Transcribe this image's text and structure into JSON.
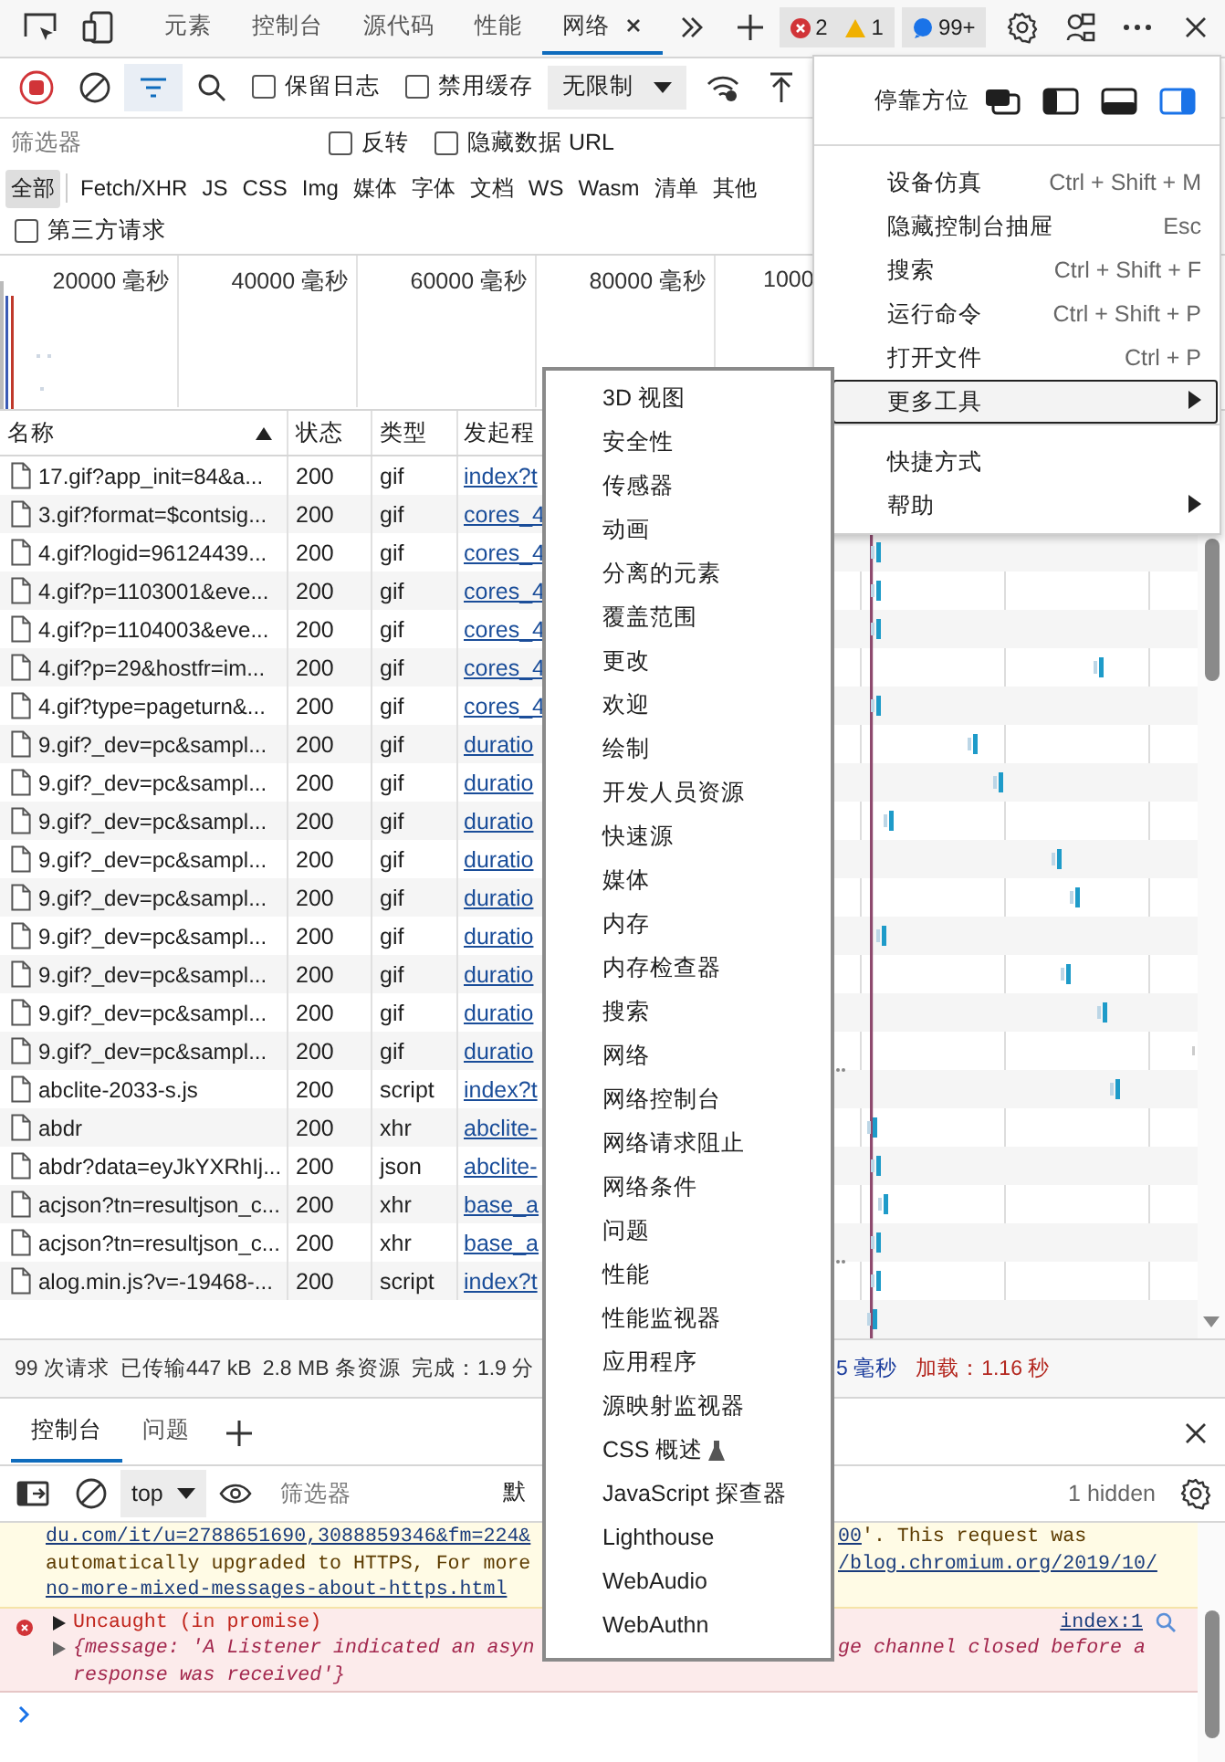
{
  "top_tabs": [
    {
      "label": "元素",
      "selected": false,
      "closable": false
    },
    {
      "label": "控制台",
      "selected": false,
      "closable": false
    },
    {
      "label": "源代码",
      "selected": false,
      "closable": false
    },
    {
      "label": "性能",
      "selected": false,
      "closable": false
    },
    {
      "label": "网络",
      "selected": true,
      "closable": true
    }
  ],
  "badges": {
    "errors": "2",
    "warnings": "1",
    "messages": "99+"
  },
  "network_toolbar": {
    "recording": true,
    "filter_active": true,
    "preserve_log": {
      "label": "保留日志",
      "checked": false
    },
    "disable_cache": {
      "label": "禁用缓存",
      "checked": false
    },
    "throttling": "无限制"
  },
  "filter": {
    "placeholder": "筛选器",
    "invert": {
      "label": "反转",
      "checked": false
    },
    "hide_data_urls": {
      "label": "隐藏数据 URL",
      "checked": false
    }
  },
  "type_filters": [
    {
      "label": "全部",
      "selected": true
    },
    {
      "label": "Fetch/XHR",
      "selected": false
    },
    {
      "label": "JS",
      "selected": false
    },
    {
      "label": "CSS",
      "selected": false
    },
    {
      "label": "Img",
      "selected": false
    },
    {
      "label": "媒体",
      "selected": false
    },
    {
      "label": "字体",
      "selected": false
    },
    {
      "label": "文档",
      "selected": false
    },
    {
      "label": "WS",
      "selected": false
    },
    {
      "label": "Wasm",
      "selected": false
    },
    {
      "label": "清单",
      "selected": false
    },
    {
      "label": "其他",
      "selected": false
    }
  ],
  "third_party": {
    "label": "第三方请求",
    "checked": false
  },
  "overview": {
    "ticks": [
      "20000 毫秒",
      "40000 毫秒",
      "60000 毫秒",
      "80000 毫秒",
      "1000"
    ]
  },
  "table": {
    "columns": [
      {
        "label": "名称",
        "sorted": true
      },
      {
        "label": "状态",
        "sorted": false
      },
      {
        "label": "类型",
        "sorted": false
      },
      {
        "label": "发起程",
        "sorted": false
      }
    ],
    "rows": [
      {
        "name": "17.gif?app_init=84&a...",
        "status": "200",
        "type": "gif",
        "initiator": "index?t"
      },
      {
        "name": "3.gif?format=$contsig...",
        "status": "200",
        "type": "gif",
        "initiator": "cores_4"
      },
      {
        "name": "4.gif?logid=96124439...",
        "status": "200",
        "type": "gif",
        "initiator": "cores_4"
      },
      {
        "name": "4.gif?p=1103001&eve...",
        "status": "200",
        "type": "gif",
        "initiator": "cores_4"
      },
      {
        "name": "4.gif?p=1104003&eve...",
        "status": "200",
        "type": "gif",
        "initiator": "cores_4"
      },
      {
        "name": "4.gif?p=29&hostfr=im...",
        "status": "200",
        "type": "gif",
        "initiator": "cores_4"
      },
      {
        "name": "4.gif?type=pageturn&...",
        "status": "200",
        "type": "gif",
        "initiator": "cores_4"
      },
      {
        "name": "9.gif?_dev=pc&sampl...",
        "status": "200",
        "type": "gif",
        "initiator": "duratio"
      },
      {
        "name": "9.gif?_dev=pc&sampl...",
        "status": "200",
        "type": "gif",
        "initiator": "duratio"
      },
      {
        "name": "9.gif?_dev=pc&sampl...",
        "status": "200",
        "type": "gif",
        "initiator": "duratio"
      },
      {
        "name": "9.gif?_dev=pc&sampl...",
        "status": "200",
        "type": "gif",
        "initiator": "duratio"
      },
      {
        "name": "9.gif?_dev=pc&sampl...",
        "status": "200",
        "type": "gif",
        "initiator": "duratio"
      },
      {
        "name": "9.gif?_dev=pc&sampl...",
        "status": "200",
        "type": "gif",
        "initiator": "duratio"
      },
      {
        "name": "9.gif?_dev=pc&sampl...",
        "status": "200",
        "type": "gif",
        "initiator": "duratio"
      },
      {
        "name": "9.gif?_dev=pc&sampl...",
        "status": "200",
        "type": "gif",
        "initiator": "duratio"
      },
      {
        "name": "9.gif?_dev=pc&sampl...",
        "status": "200",
        "type": "gif",
        "initiator": "duratio"
      },
      {
        "name": "abclite-2033-s.js",
        "status": "200",
        "type": "script",
        "initiator": "index?t"
      },
      {
        "name": "abdr",
        "status": "200",
        "type": "xhr",
        "initiator": "abclite-"
      },
      {
        "name": "abdr?data=eyJkYXRhIj...",
        "status": "200",
        "type": "json",
        "initiator": "abclite-"
      },
      {
        "name": "acjson?tn=resultjson_c...",
        "status": "200",
        "type": "xhr",
        "initiator": "base_a"
      },
      {
        "name": "acjson?tn=resultjson_c...",
        "status": "200",
        "type": "xhr",
        "initiator": "base_a"
      },
      {
        "name": "alog.min.js?v=-19468-...",
        "status": "200",
        "type": "script",
        "initiator": "index?t"
      }
    ]
  },
  "status_bar": {
    "left": [
      {
        "text": "99 次请求",
        "kind": "plain"
      },
      {
        "text": "已传输447 kB",
        "kind": "plain"
      },
      {
        "text": "2.8 MB 条资源",
        "kind": "plain"
      },
      {
        "text": "完成：1.9 分",
        "kind": "plain"
      }
    ],
    "right": [
      {
        "text": "5 毫秒",
        "kind": "domcontent"
      },
      {
        "text": "加载：1.16 秒",
        "kind": "load"
      }
    ]
  },
  "drawer_tabs": [
    {
      "label": "控制台",
      "selected": true
    },
    {
      "label": "问题",
      "selected": false
    }
  ],
  "console_toolbar": {
    "context": "top",
    "filter_placeholder": "筛选器",
    "levels": "默",
    "hidden": "1 hidden"
  },
  "console_messages": [
    {
      "kind": "warning",
      "lines": [
        {
          "left": [
            {
              "text": "du.com/it/u=2788651690,3088859346&fm=224&",
              "kind": "link"
            }
          ],
          "right": [
            {
              "text": "00",
              "kind": "link"
            },
            {
              "text": "'. This request was",
              "kind": "plain"
            }
          ]
        },
        {
          "left": [
            {
              "text": "automatically upgraded to HTTPS, For more",
              "kind": "plain"
            }
          ],
          "right": [
            {
              "text": "/blog.chromium.org/2019/10/",
              "kind": "link"
            }
          ]
        },
        {
          "left": [
            {
              "text": "no-more-mixed-messages-about-https.html",
              "kind": "link"
            }
          ]
        }
      ]
    },
    {
      "kind": "error",
      "source": "index:1",
      "lines": [
        {
          "expanded": false,
          "left": [
            {
              "text": "Uncaught (in promise)",
              "kind": "plain"
            }
          ]
        },
        {
          "expanded": false,
          "left": [
            {
              "text": "{message: 'A Listener indicated an asyn",
              "kind": "italic"
            }
          ],
          "right": [
            {
              "text": "ge channel closed before a",
              "kind": "italic"
            }
          ]
        },
        {
          "left": [
            {
              "text": "response was received'}",
              "kind": "italic"
            }
          ]
        }
      ]
    }
  ],
  "main_menu": {
    "dock": {
      "label": "停靠方位",
      "options": [
        {
          "kind": "undock",
          "selected": false
        },
        {
          "kind": "left",
          "selected": false
        },
        {
          "kind": "bottom",
          "selected": false
        },
        {
          "kind": "right",
          "selected": true
        }
      ]
    },
    "groups": [
      [
        {
          "label": "设备仿真",
          "shortcut": "Ctrl + Shift + M",
          "has_submenu": false,
          "highlighted": false
        },
        {
          "label": "隐藏控制台抽屉",
          "shortcut": "Esc",
          "has_submenu": false,
          "highlighted": false
        },
        {
          "label": "搜索",
          "shortcut": "Ctrl + Shift + F",
          "has_submenu": false,
          "highlighted": false
        },
        {
          "label": "运行命令",
          "shortcut": "Ctrl + Shift + P",
          "has_submenu": false,
          "highlighted": false
        },
        {
          "label": "打开文件",
          "shortcut": "Ctrl + P",
          "has_submenu": false,
          "highlighted": false
        },
        {
          "label": "更多工具",
          "has_submenu": true,
          "highlighted": true
        }
      ],
      [
        {
          "label": "快捷方式",
          "has_submenu": false,
          "highlighted": false
        },
        {
          "label": "帮助",
          "has_submenu": true,
          "highlighted": false
        }
      ]
    ]
  },
  "submenu": [
    {
      "label": "3D 视图",
      "experimental": false
    },
    {
      "label": "安全性",
      "experimental": false
    },
    {
      "label": "传感器",
      "experimental": false
    },
    {
      "label": "动画",
      "experimental": false
    },
    {
      "label": "分离的元素",
      "experimental": false
    },
    {
      "label": "覆盖范围",
      "experimental": false
    },
    {
      "label": "更改",
      "experimental": false
    },
    {
      "label": "欢迎",
      "experimental": false
    },
    {
      "label": "绘制",
      "experimental": false
    },
    {
      "label": "开发人员资源",
      "experimental": false
    },
    {
      "label": "快速源",
      "experimental": false
    },
    {
      "label": "媒体",
      "experimental": false
    },
    {
      "label": "内存",
      "experimental": false
    },
    {
      "label": "内存检查器",
      "experimental": false
    },
    {
      "label": "搜索",
      "experimental": false
    },
    {
      "label": "网络",
      "experimental": false
    },
    {
      "label": "网络控制台",
      "experimental": false
    },
    {
      "label": "网络请求阻止",
      "experimental": false
    },
    {
      "label": "网络条件",
      "experimental": false
    },
    {
      "label": "问题",
      "experimental": false
    },
    {
      "label": "性能",
      "experimental": false
    },
    {
      "label": "性能监视器",
      "experimental": false
    },
    {
      "label": "应用程序",
      "experimental": false
    },
    {
      "label": "源映射监视器",
      "experimental": false
    },
    {
      "label": "CSS 概述",
      "experimental": true
    },
    {
      "label": "JavaScript 探查器",
      "experimental": false
    },
    {
      "label": "Lighthouse",
      "experimental": false
    },
    {
      "label": "WebAudio",
      "experimental": false
    },
    {
      "label": "WebAuthn",
      "experimental": false
    }
  ]
}
